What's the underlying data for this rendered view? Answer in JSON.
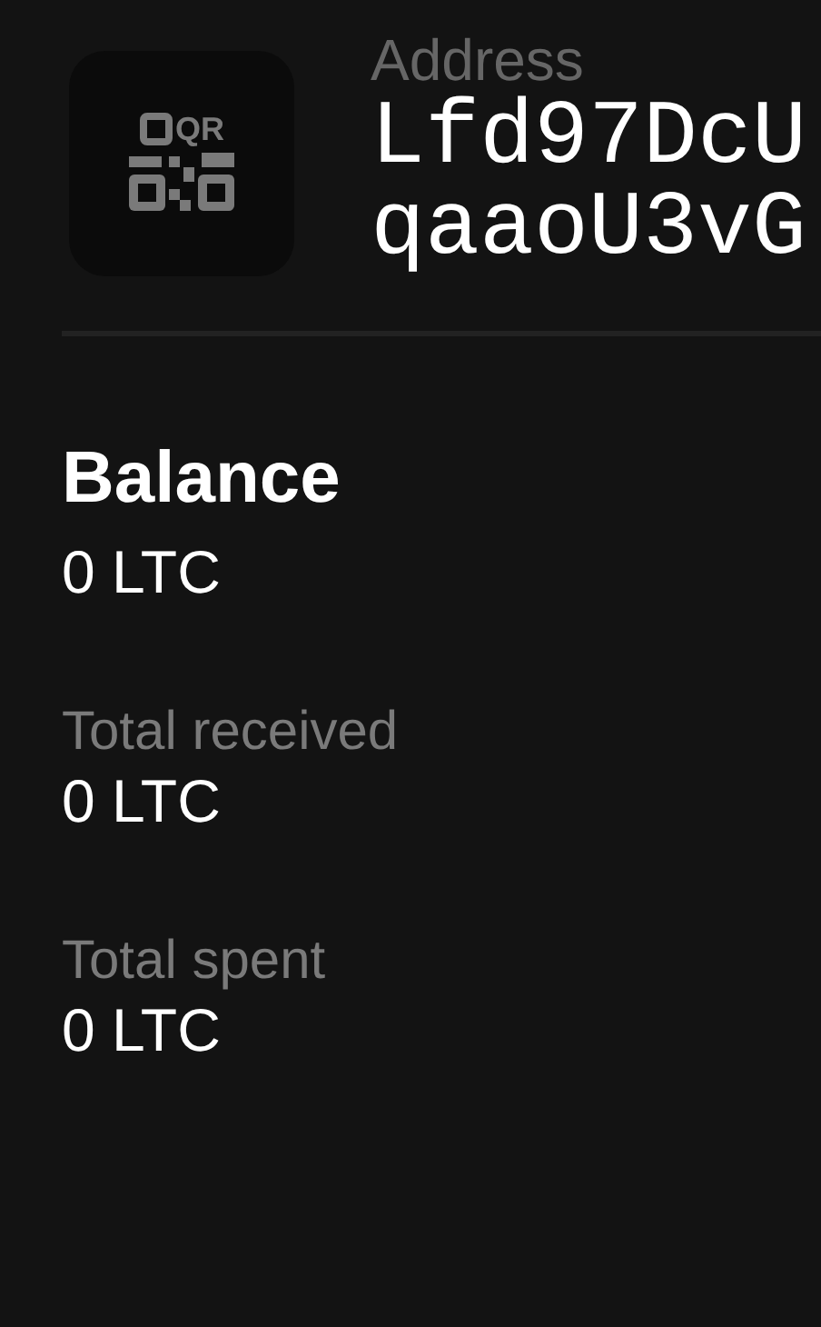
{
  "address": {
    "icon_text": "QR",
    "label": "Address",
    "lines": [
      "Lfd97DcU",
      "qaaoU3vG"
    ]
  },
  "balance": {
    "label": "Balance",
    "value": "0 LTC"
  },
  "stats": [
    {
      "label": "Total received",
      "value": "0 LTC"
    },
    {
      "label": "Total spent",
      "value": "0 LTC"
    }
  ]
}
